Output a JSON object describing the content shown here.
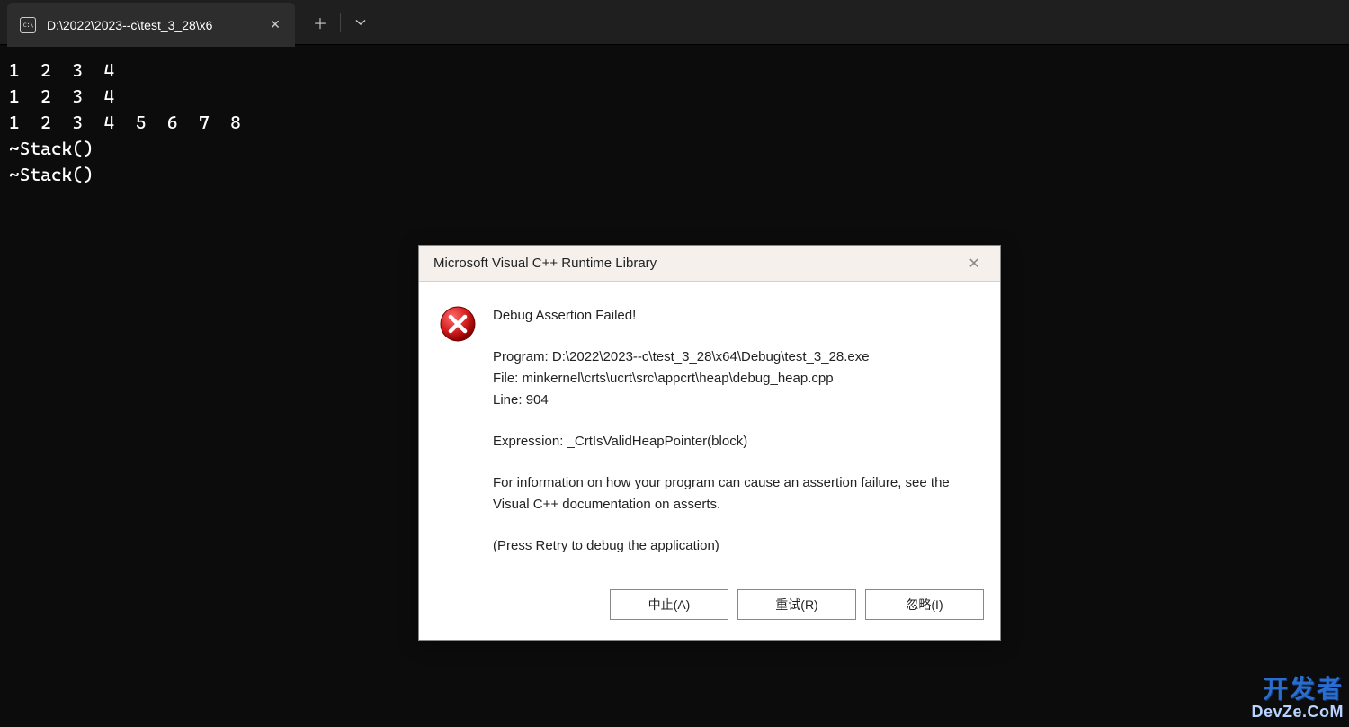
{
  "tab": {
    "title": "D:\\2022\\2023--c\\test_3_28\\x6",
    "icon_label": "c:\\"
  },
  "console_output": "1  2  3  4\n1  2  3  4\n1  2  3  4  5  6  7  8\n~Stack()\n~Stack()",
  "dialog": {
    "title": "Microsoft Visual C++ Runtime Library",
    "heading": "Debug Assertion Failed!",
    "program_label": "Program: ",
    "program_value": "D:\\2022\\2023--c\\test_3_28\\x64\\Debug\\test_3_28.exe",
    "file_label": "File: ",
    "file_value": "minkernel\\crts\\ucrt\\src\\appcrt\\heap\\debug_heap.cpp",
    "line_label": "Line: ",
    "line_value": "904",
    "expression_label": "Expression: ",
    "expression_value": "_CrtIsValidHeapPointer(block)",
    "note": "For information on how your program can cause an assertion failure, see the Visual C++ documentation on asserts.",
    "retry_hint": "(Press Retry to debug the application)",
    "buttons": {
      "abort": "中止(A)",
      "retry": "重试(R)",
      "ignore": "忽略(I)"
    }
  },
  "watermark": {
    "top": "开发者",
    "bottom": "DevZe.CoM"
  }
}
